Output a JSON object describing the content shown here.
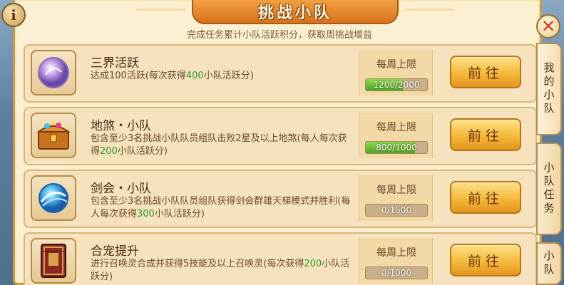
{
  "title": "挑战小队",
  "subtitle": "完成任务累计小队活跃积分，获取周挑战增益",
  "info_label": "i",
  "close_label": "✕",
  "tasks": [
    {
      "name": "三界活跃",
      "desc": [
        {
          "t": "达成100活跃(每次获得",
          "hl": false
        },
        {
          "t": "400",
          "hl": true
        },
        {
          "t": "小队活跃分)",
          "hl": false
        }
      ],
      "limit_label": "每周上限",
      "progress_text": "1200/2000",
      "progress": 0.6,
      "button": "前往",
      "icon": "crystal-orb-icon"
    },
    {
      "name": "地煞・小队",
      "desc": [
        {
          "t": "包含至少3名挑战小队队员组队击败2星及以上地煞(每人每次获得",
          "hl": false
        },
        {
          "t": "200",
          "hl": true
        },
        {
          "t": "小队活跃分)",
          "hl": false
        }
      ],
      "limit_label": "每周上限",
      "progress_text": "800/1000",
      "progress": 0.8,
      "button": "前往",
      "icon": "treasure-chest-icon"
    },
    {
      "name": "剑会・小队",
      "desc": [
        {
          "t": "包含至少3名挑战小队队员组队获得剑会群雄天梯模式并胜利(每人每次获得",
          "hl": false
        },
        {
          "t": "300",
          "hl": true
        },
        {
          "t": "小队活跃分)",
          "hl": false
        }
      ],
      "limit_label": "每周上限",
      "progress_text": "0/1500",
      "progress": 0,
      "button": "前往",
      "icon": "blue-orb-icon"
    },
    {
      "name": "合宠提升",
      "desc": [
        {
          "t": "进行召唤灵合成并获得5技能及以上召唤灵(每次获得",
          "hl": false
        },
        {
          "t": "200",
          "hl": true
        },
        {
          "t": "小队活跃分)",
          "hl": false
        }
      ],
      "limit_label": "每周上限",
      "progress_text": "0/1000",
      "progress": 0,
      "button": "前往",
      "icon": "red-book-icon"
    }
  ],
  "side_tabs": [
    "我的小队",
    "小队任务",
    "小队"
  ],
  "colors": {
    "accent": "#f4b93c",
    "highlight": "#2b9a2a",
    "progress": "#4aa622"
  }
}
